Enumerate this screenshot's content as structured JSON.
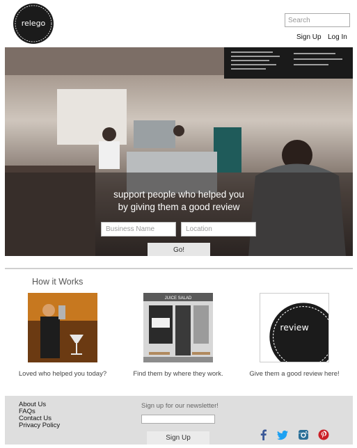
{
  "brand": {
    "logo_text": "relego"
  },
  "header": {
    "search_placeholder": "Search",
    "signup": "Sign Up",
    "login": "Log In"
  },
  "hero": {
    "line1": "support people who helped you",
    "line2": "by giving them a good review",
    "business_placeholder": "Business Name",
    "location_placeholder": "Location",
    "go_label": "Go!"
  },
  "how_it_works": {
    "title": "How it Works",
    "steps": [
      {
        "caption": "Loved who helped you today?"
      },
      {
        "caption": "Find them by where they work."
      },
      {
        "caption": "Give them a good review here!",
        "badge": "review"
      }
    ],
    "shop_sign": "JUICE SALAD"
  },
  "footer": {
    "links": [
      "About Us",
      "FAQs",
      "Contact Us",
      "Privacy Policy"
    ],
    "newsletter_label": "Sign up for our newsletter!",
    "newsletter_button": "Sign Up",
    "social": [
      {
        "icon": "facebook-icon",
        "color": "#3b5998"
      },
      {
        "icon": "twitter-icon",
        "color": "#1da1f2"
      },
      {
        "icon": "instagram-icon",
        "color": "#2a6f97"
      },
      {
        "icon": "pinterest-icon",
        "color": "#cb2027"
      }
    ]
  },
  "colors": {
    "badge": "#1b1b1b",
    "footer_bg": "#dedede"
  }
}
